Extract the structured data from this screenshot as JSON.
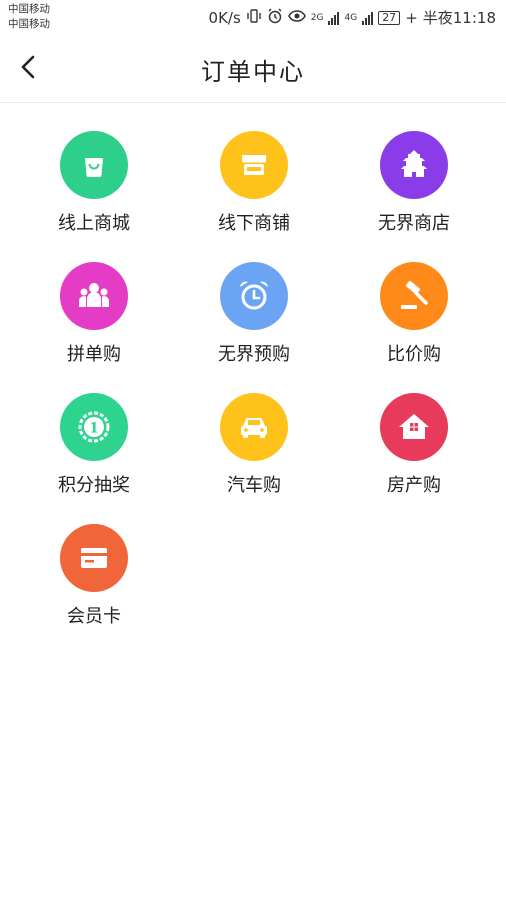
{
  "status_bar": {
    "carrier_1": "中国移动",
    "carrier_2": "中国移动",
    "net_speed": "0K/s",
    "net_2g": "2G",
    "net_4g": "4G",
    "battery": "27",
    "time": "半夜11:18"
  },
  "header": {
    "title": "订单中心",
    "back_icon": "chevron-left-icon"
  },
  "colors": {
    "green": "#2ecf8b",
    "yellow": "#ffc21a",
    "purple": "#8a3ce8",
    "pink": "#e43cc4",
    "blue": "#6aa4f2",
    "orange": "#ff8a1a",
    "red": "#e83a5a",
    "card_orange": "#f0663a"
  },
  "grid": {
    "items": [
      {
        "label": "线上商城",
        "icon": "shopping-bag-icon"
      },
      {
        "label": "线下商铺",
        "icon": "storefront-icon"
      },
      {
        "label": "无界商店",
        "icon": "pagoda-icon"
      },
      {
        "label": "拼单购",
        "icon": "group-people-icon"
      },
      {
        "label": "无界预购",
        "icon": "alarm-clock-icon"
      },
      {
        "label": "比价购",
        "icon": "gavel-icon"
      },
      {
        "label": "积分抽奖",
        "icon": "medal-icon"
      },
      {
        "label": "汽车购",
        "icon": "car-icon"
      },
      {
        "label": "房产购",
        "icon": "house-icon"
      },
      {
        "label": "会员卡",
        "icon": "card-icon"
      }
    ]
  }
}
